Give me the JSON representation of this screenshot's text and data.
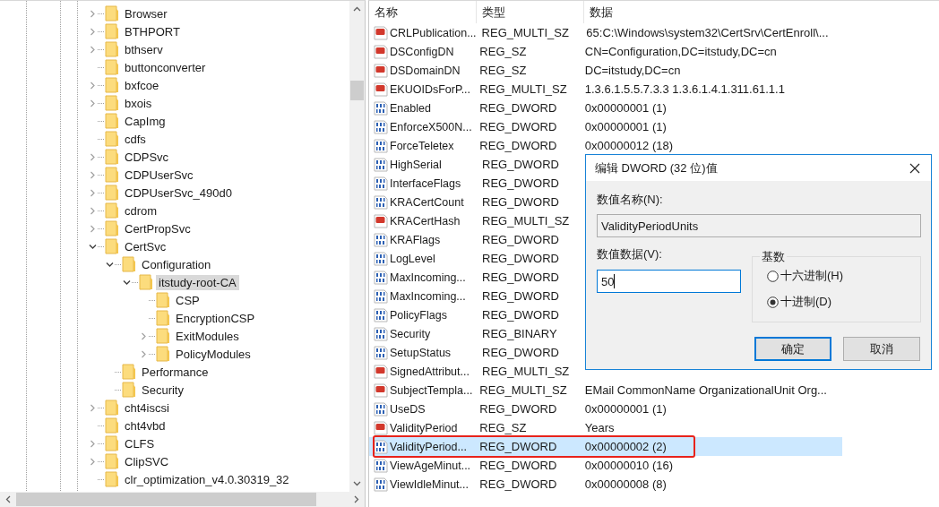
{
  "tree": {
    "items": [
      {
        "label": "Browser",
        "expanded": false,
        "selected": false
      },
      {
        "label": "BTHPORT",
        "expanded": false,
        "selected": false
      },
      {
        "label": "bthserv",
        "expanded": false,
        "selected": false
      },
      {
        "label": "buttonconverter",
        "selected": false
      },
      {
        "label": "bxfcoe",
        "expanded": false,
        "selected": false
      },
      {
        "label": "bxois",
        "expanded": false,
        "selected": false
      },
      {
        "label": "CapImg",
        "selected": false
      },
      {
        "label": "cdfs",
        "selected": false
      },
      {
        "label": "CDPSvc",
        "expanded": false,
        "selected": false
      },
      {
        "label": "CDPUserSvc",
        "expanded": false,
        "selected": false
      },
      {
        "label": "CDPUserSvc_490d0",
        "expanded": false,
        "selected": false
      },
      {
        "label": "cdrom",
        "expanded": false,
        "selected": false
      },
      {
        "label": "CertPropSvc",
        "expanded": false,
        "selected": false
      },
      {
        "label": "CertSvc",
        "expanded": true,
        "selected": false,
        "children": [
          {
            "label": "Configuration",
            "expanded": true,
            "selected": false,
            "children": [
              {
                "label": "itstudy-root-CA",
                "expanded": true,
                "selected": true,
                "children": [
                  {
                    "label": "CSP",
                    "selected": false
                  },
                  {
                    "label": "EncryptionCSP",
                    "selected": false
                  },
                  {
                    "label": "ExitModules",
                    "expanded": false,
                    "selected": false
                  },
                  {
                    "label": "PolicyModules",
                    "expanded": false,
                    "selected": false
                  }
                ]
              }
            ]
          },
          {
            "label": "Performance",
            "selected": false
          },
          {
            "label": "Security",
            "selected": false
          }
        ]
      },
      {
        "label": "cht4iscsi",
        "expanded": false,
        "selected": false
      },
      {
        "label": "cht4vbd",
        "selected": false
      },
      {
        "label": "CLFS",
        "expanded": false,
        "selected": false
      },
      {
        "label": "ClipSVC",
        "expanded": false,
        "selected": false
      },
      {
        "label": "clr_optimization_v4.0.30319_32",
        "selected": false
      }
    ]
  },
  "values": {
    "columns": [
      "名称",
      "类型",
      "数据"
    ],
    "rows": [
      {
        "kind": "string",
        "name": "CRLPublication...",
        "type": "REG_MULTI_SZ",
        "data": "65:C:\\Windows\\system32\\CertSrv\\CertEnroll\\...",
        "selected": false,
        "annotated": false
      },
      {
        "kind": "string",
        "name": "DSConfigDN",
        "type": "REG_SZ",
        "data": "CN=Configuration,DC=itstudy,DC=cn",
        "selected": false,
        "annotated": false
      },
      {
        "kind": "string",
        "name": "DSDomainDN",
        "type": "REG_SZ",
        "data": "DC=itstudy,DC=cn",
        "selected": false,
        "annotated": false
      },
      {
        "kind": "string",
        "name": "EKUOIDsForP...",
        "type": "REG_MULTI_SZ",
        "data": "1.3.6.1.5.5.7.3.3 1.3.6.1.4.1.311.61.1.1",
        "selected": false,
        "annotated": false
      },
      {
        "kind": "binary",
        "name": "Enabled",
        "type": "REG_DWORD",
        "data": "0x00000001 (1)",
        "selected": false,
        "annotated": false
      },
      {
        "kind": "binary",
        "name": "EnforceX500N...",
        "type": "REG_DWORD",
        "data": "0x00000001 (1)",
        "selected": false,
        "annotated": false
      },
      {
        "kind": "binary",
        "name": "ForceTeletex",
        "type": "REG_DWORD",
        "data": "0x00000012 (18)",
        "selected": false,
        "annotated": false
      },
      {
        "kind": "binary",
        "name": "HighSerial",
        "type": "REG_DWORD",
        "selected": false,
        "annotated": false
      },
      {
        "kind": "binary",
        "name": "InterfaceFlags",
        "type": "REG_DWORD",
        "selected": false,
        "annotated": false
      },
      {
        "kind": "binary",
        "name": "KRACertCount",
        "type": "REG_DWORD",
        "selected": false,
        "annotated": false
      },
      {
        "kind": "string",
        "name": "KRACertHash",
        "type": "REG_MULTI_SZ",
        "selected": false,
        "annotated": false
      },
      {
        "kind": "binary",
        "name": "KRAFlags",
        "type": "REG_DWORD",
        "selected": false,
        "annotated": false
      },
      {
        "kind": "binary",
        "name": "LogLevel",
        "type": "REG_DWORD",
        "selected": false,
        "annotated": false
      },
      {
        "kind": "binary",
        "name": "MaxIncoming...",
        "type": "REG_DWORD",
        "selected": false,
        "annotated": false
      },
      {
        "kind": "binary",
        "name": "MaxIncoming...",
        "type": "REG_DWORD",
        "selected": false,
        "annotated": false
      },
      {
        "kind": "binary",
        "name": "PolicyFlags",
        "type": "REG_DWORD",
        "selected": false,
        "annotated": false
      },
      {
        "kind": "binary",
        "name": "Security",
        "type": "REG_BINARY",
        "selected": false,
        "annotated": false
      },
      {
        "kind": "binary",
        "name": "SetupStatus",
        "type": "REG_DWORD",
        "selected": false,
        "annotated": false
      },
      {
        "kind": "string",
        "name": "SignedAttribut...",
        "type": "REG_MULTI_SZ",
        "selected": false,
        "annotated": false
      },
      {
        "kind": "string",
        "name": "SubjectTempla...",
        "type": "REG_MULTI_SZ",
        "data": "EMail CommonName OrganizationalUnit Org...",
        "selected": false,
        "annotated": false
      },
      {
        "kind": "binary",
        "name": "UseDS",
        "type": "REG_DWORD",
        "data": "0x00000001 (1)",
        "selected": false,
        "annotated": false
      },
      {
        "kind": "string",
        "name": "ValidityPeriod",
        "type": "REG_SZ",
        "data": "Years",
        "selected": false,
        "annotated": false
      },
      {
        "kind": "binary",
        "name": "ValidityPeriod...",
        "type": "REG_DWORD",
        "data": "0x00000002 (2)",
        "selected": true,
        "annotated": true
      },
      {
        "kind": "binary",
        "name": "ViewAgeMinut...",
        "type": "REG_DWORD",
        "data": "0x00000010 (16)",
        "selected": false,
        "annotated": false
      },
      {
        "kind": "binary",
        "name": "ViewIdleMinut...",
        "type": "REG_DWORD",
        "data": "0x00000008 (8)",
        "selected": false,
        "annotated": false
      }
    ]
  },
  "dialog": {
    "title": "编辑 DWORD (32 位)值",
    "name_label": "数值名称(N):",
    "name_value": "ValidityPeriodUnits",
    "data_label": "数值数据(V):",
    "data_value": "50",
    "base_label": "基数",
    "radios": [
      {
        "label": "十六进制(H)",
        "selected": false
      },
      {
        "label": "十进制(D)",
        "selected": true
      }
    ],
    "buttons": [
      {
        "label": "确定",
        "default": true
      },
      {
        "label": "取消",
        "default": false
      }
    ]
  }
}
